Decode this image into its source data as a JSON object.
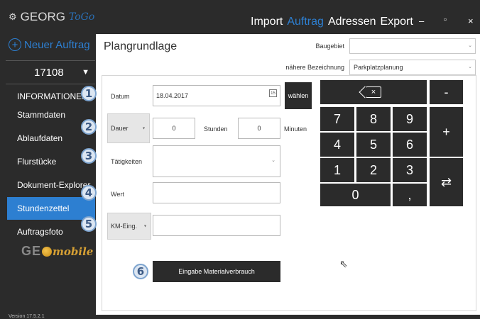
{
  "app": {
    "brand_name": "GEORG",
    "brand_suffix": "ToGo",
    "menu": [
      "Import",
      "Auftrag",
      "Adressen",
      "Export"
    ],
    "active_menu": "Auftrag",
    "minimize_label": "–",
    "maximize_label": "▫",
    "close_label": "×"
  },
  "sidebar": {
    "new_order_label": "Neuer Auftrag",
    "order_number": "17108",
    "items": [
      {
        "label": "INFORMATIONEN",
        "badge": "1"
      },
      {
        "label": "Stammdaten",
        "badge": ""
      },
      {
        "label": "Ablaufdaten",
        "badge": "2"
      },
      {
        "label": "Flurstücke",
        "badge": "3"
      },
      {
        "label": "Dokument-Explorer",
        "badge": "4"
      },
      {
        "label": "Stundenzettel",
        "badge": ""
      },
      {
        "label": "Auftragsfoto",
        "badge": "5"
      }
    ],
    "active_item": "Stundenzettel",
    "logo_geo": "GE",
    "logo_mobile": "mobile",
    "version": "Version 17.5.2.1"
  },
  "main": {
    "title": "Plangrundlage",
    "baugebiet_label": "Baugebiet",
    "baugebiet_value": "",
    "bezeichnung_label": "nähere Bezeichnung",
    "bezeichnung_value": "Parkplatzplanung",
    "datum_label": "Datum",
    "datum_value": "18.04.2017",
    "calendar_icon_text": "15",
    "waehlen_label": "wählen",
    "dauer_label": "Dauer",
    "stunden_value": "0",
    "stunden_label": "Stunden",
    "minuten_value": "0",
    "minuten_label": "Minuten",
    "taetigkeiten_label": "Tätigkeiten",
    "wert_label": "Wert",
    "km_label": "KM-Eing.",
    "material_button": "Eingabe Materialverbrauch",
    "badge_6": "6"
  },
  "keypad": {
    "digits": [
      "7",
      "8",
      "9",
      "4",
      "5",
      "6",
      "1",
      "2",
      "3",
      "0",
      ","
    ],
    "minus": "-",
    "plus": "+",
    "swap": "⇄",
    "backspace": "×"
  }
}
